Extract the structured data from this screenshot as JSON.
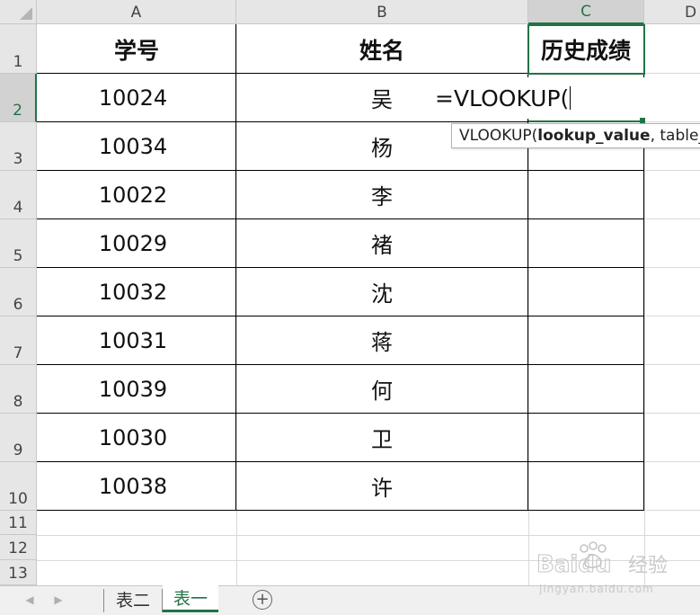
{
  "columns": [
    "A",
    "B",
    "C",
    "D"
  ],
  "row_numbers": [
    "1",
    "2",
    "3",
    "4",
    "5",
    "6",
    "7",
    "8",
    "9",
    "10",
    "11",
    "12",
    "13"
  ],
  "table": {
    "headers": [
      "学号",
      "姓名",
      "历史成绩"
    ],
    "rows": [
      {
        "id": "10024",
        "name": "吴"
      },
      {
        "id": "10034",
        "name": "杨"
      },
      {
        "id": "10022",
        "name": "李"
      },
      {
        "id": "10029",
        "name": "褚"
      },
      {
        "id": "10032",
        "name": "沈"
      },
      {
        "id": "10031",
        "name": "蒋"
      },
      {
        "id": "10039",
        "name": "何"
      },
      {
        "id": "10030",
        "name": "卫"
      },
      {
        "id": "10038",
        "name": "许"
      }
    ]
  },
  "editing": {
    "formula": "=VLOOKUP(",
    "tooltip_fn": "VLOOKUP(",
    "tooltip_arg": "lookup_value",
    "tooltip_rest": ", table_"
  },
  "sheet_tabs": [
    "表二",
    "表一"
  ],
  "active_tab": "表一",
  "add_sheet_icon": "plus-circle-icon",
  "watermark": {
    "logo": "Baidu经验",
    "url": "jingyan.baidu.com"
  },
  "colors": {
    "accent": "#217346",
    "header_bg": "#e6e6e6",
    "gridline": "#d9d9d9"
  }
}
